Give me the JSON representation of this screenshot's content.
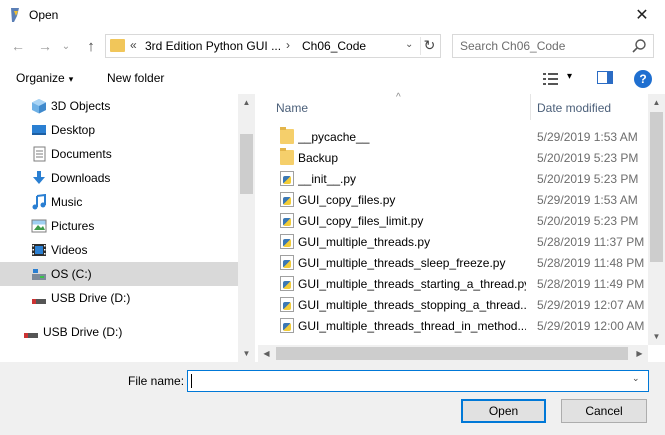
{
  "window": {
    "title": "Open",
    "close_glyph": "✕",
    "icon": "python-feather-icon"
  },
  "nav": {
    "back_glyph": "←",
    "forward_glyph": "→",
    "recent_glyph": "⌄",
    "up_glyph": "↑",
    "address": {
      "prefix": "«",
      "segment1": "3rd Edition Python GUI ...",
      "separator": "›",
      "segment2": "Ch06_Code",
      "dropdown_glyph": "⌄",
      "refresh_glyph": "↻"
    },
    "search_placeholder": "Search Ch06_Code"
  },
  "toolbar": {
    "organize_label": "Organize",
    "organize_caret": "▾",
    "new_folder_label": "New folder",
    "view_caret": "▾",
    "help_label": "?"
  },
  "sidebar": {
    "items": [
      {
        "label": "3D Objects",
        "icon": "3d-objects-icon"
      },
      {
        "label": "Desktop",
        "icon": "desktop-icon"
      },
      {
        "label": "Documents",
        "icon": "documents-icon"
      },
      {
        "label": "Downloads",
        "icon": "downloads-icon"
      },
      {
        "label": "Music",
        "icon": "music-icon"
      },
      {
        "label": "Pictures",
        "icon": "pictures-icon"
      },
      {
        "label": "Videos",
        "icon": "videos-icon"
      },
      {
        "label": "OS (C:)",
        "icon": "drive-icon",
        "selected": true
      },
      {
        "label": "USB Drive (D:)",
        "icon": "usb-drive-icon"
      },
      {
        "label": "USB Drive (D:)",
        "icon": "usb-drive-icon"
      }
    ],
    "scroll_up": "▲",
    "scroll_down": "▼"
  },
  "files": {
    "columns": {
      "name": "Name",
      "date": "Date modified",
      "sort_glyph": "^"
    },
    "rows": [
      {
        "name": "__pycache__",
        "date": "5/29/2019 1:53 AM",
        "type": "folder"
      },
      {
        "name": "Backup",
        "date": "5/20/2019 5:23 PM",
        "type": "folder"
      },
      {
        "name": "__init__.py",
        "date": "5/20/2019 5:23 PM",
        "type": "py"
      },
      {
        "name": "GUI_copy_files.py",
        "date": "5/29/2019 1:53 AM",
        "type": "py"
      },
      {
        "name": "GUI_copy_files_limit.py",
        "date": "5/20/2019 5:23 PM",
        "type": "py"
      },
      {
        "name": "GUI_multiple_threads.py",
        "date": "5/28/2019 11:37 PM",
        "type": "py"
      },
      {
        "name": "GUI_multiple_threads_sleep_freeze.py",
        "date": "5/28/2019 11:48 PM",
        "type": "py"
      },
      {
        "name": "GUI_multiple_threads_starting_a_thread.py",
        "date": "5/28/2019 11:49 PM",
        "type": "py"
      },
      {
        "name": "GUI_multiple_threads_stopping_a_thread....",
        "date": "5/29/2019 12:07 AM",
        "type": "py"
      },
      {
        "name": "GUI_multiple_threads_thread_in_method....",
        "date": "5/29/2019 12:00 AM",
        "type": "py"
      }
    ],
    "scroll_up": "▲",
    "scroll_down": "▼",
    "scroll_left": "◀",
    "scroll_right": "▶"
  },
  "footer": {
    "file_name_label": "File name:",
    "file_name_value": "",
    "dropdown_glyph": "⌄",
    "open_label": "Open",
    "cancel_label": "Cancel"
  },
  "colors": {
    "accent": "#0078d7",
    "folder": "#f5cf6b",
    "selected_bg": "#d9d9d9",
    "header_text": "#4c607a"
  }
}
